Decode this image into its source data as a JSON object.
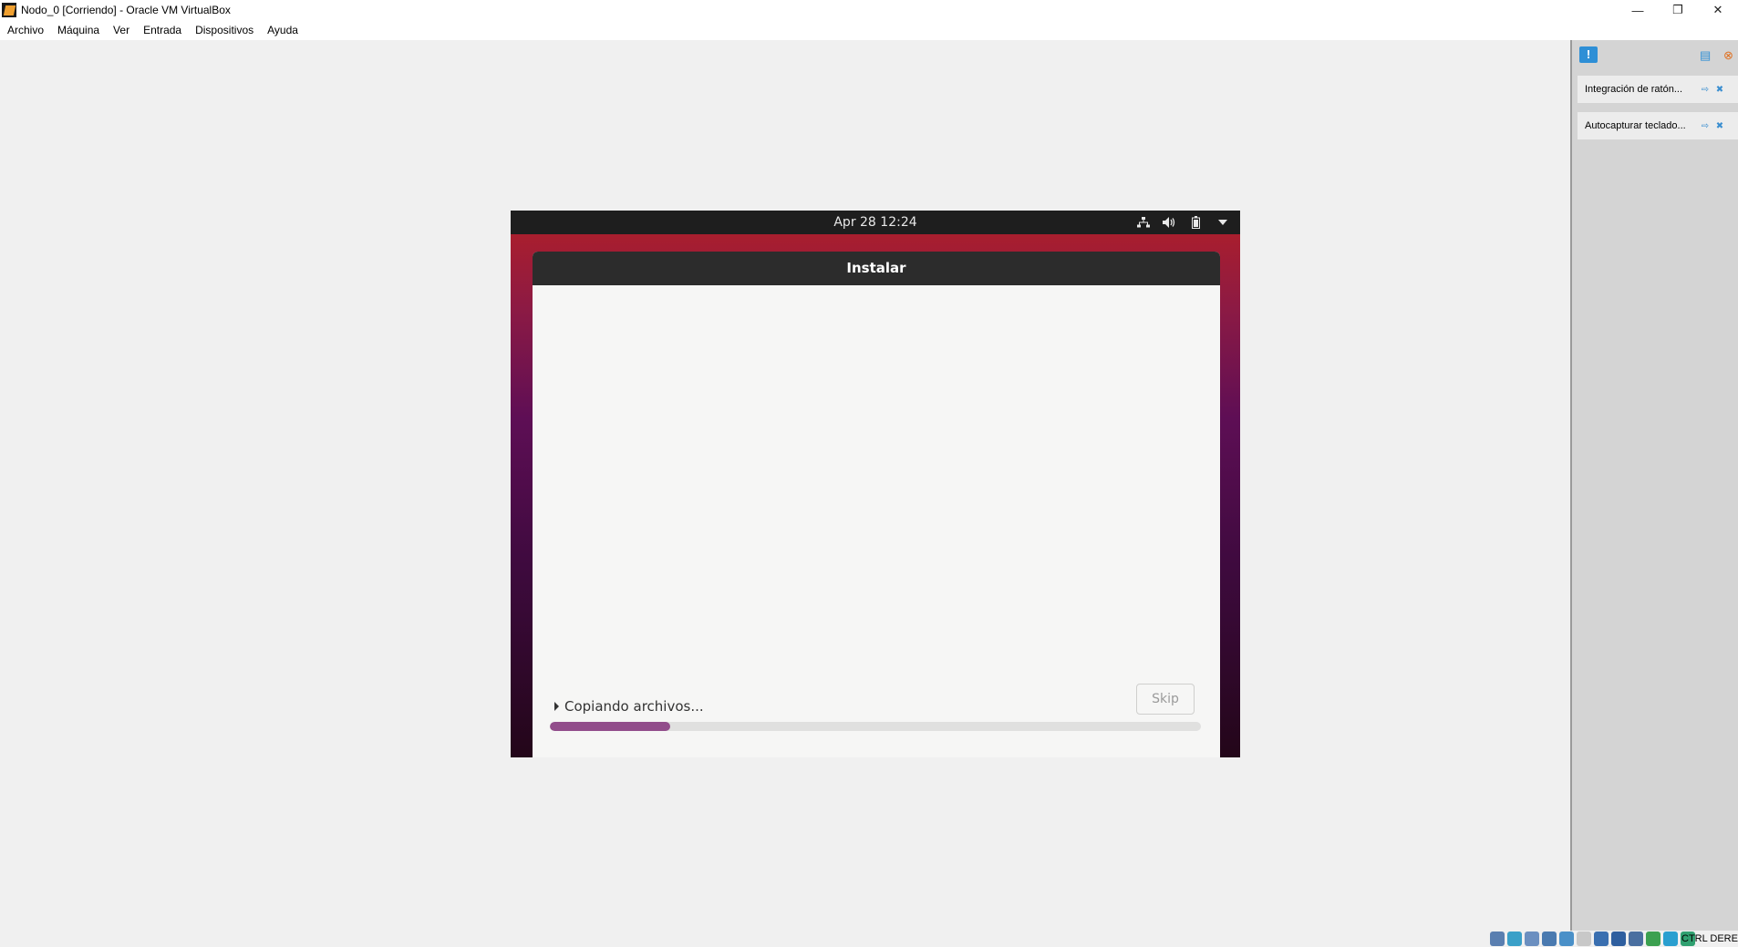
{
  "window": {
    "title": "Nodo_0 [Corriendo] - Oracle VM VirtualBox",
    "minimize_glyph": "—",
    "restore_glyph": "❐",
    "close_glyph": "✕"
  },
  "menu": {
    "items": [
      {
        "label": "Archivo"
      },
      {
        "label": "Máquina"
      },
      {
        "label": "Ver"
      },
      {
        "label": "Entrada"
      },
      {
        "label": "Dispositivos"
      },
      {
        "label": "Ayuda"
      }
    ]
  },
  "guest": {
    "topbar": {
      "clock": "Apr 28  12:24",
      "tray_icons": [
        "network-icon",
        "volume-icon",
        "battery-icon",
        "system-menu-arrow-icon"
      ]
    },
    "installer": {
      "title": "Instalar",
      "status_text": "Copiando archivos...",
      "skip_label": "Skip",
      "progress_fraction": 0.185,
      "progress_color": "#924d8b"
    }
  },
  "side_panel": {
    "notices": [
      {
        "text": "Integración de ratón..."
      },
      {
        "text": "Autocapturar teclado..."
      }
    ]
  },
  "statusbar": {
    "host_key_label": "CTRL DERECHA",
    "icons": [
      "hard-disk-icon",
      "optical-drive-icon",
      "audio-icon",
      "network-adapter-icon",
      "usb-icon",
      "shared-folders-icon",
      "display-icon",
      "video-capture-icon",
      "recording-icon",
      "cpu-icon",
      "mouse-integration-icon",
      "keyboard-capture-icon"
    ]
  }
}
